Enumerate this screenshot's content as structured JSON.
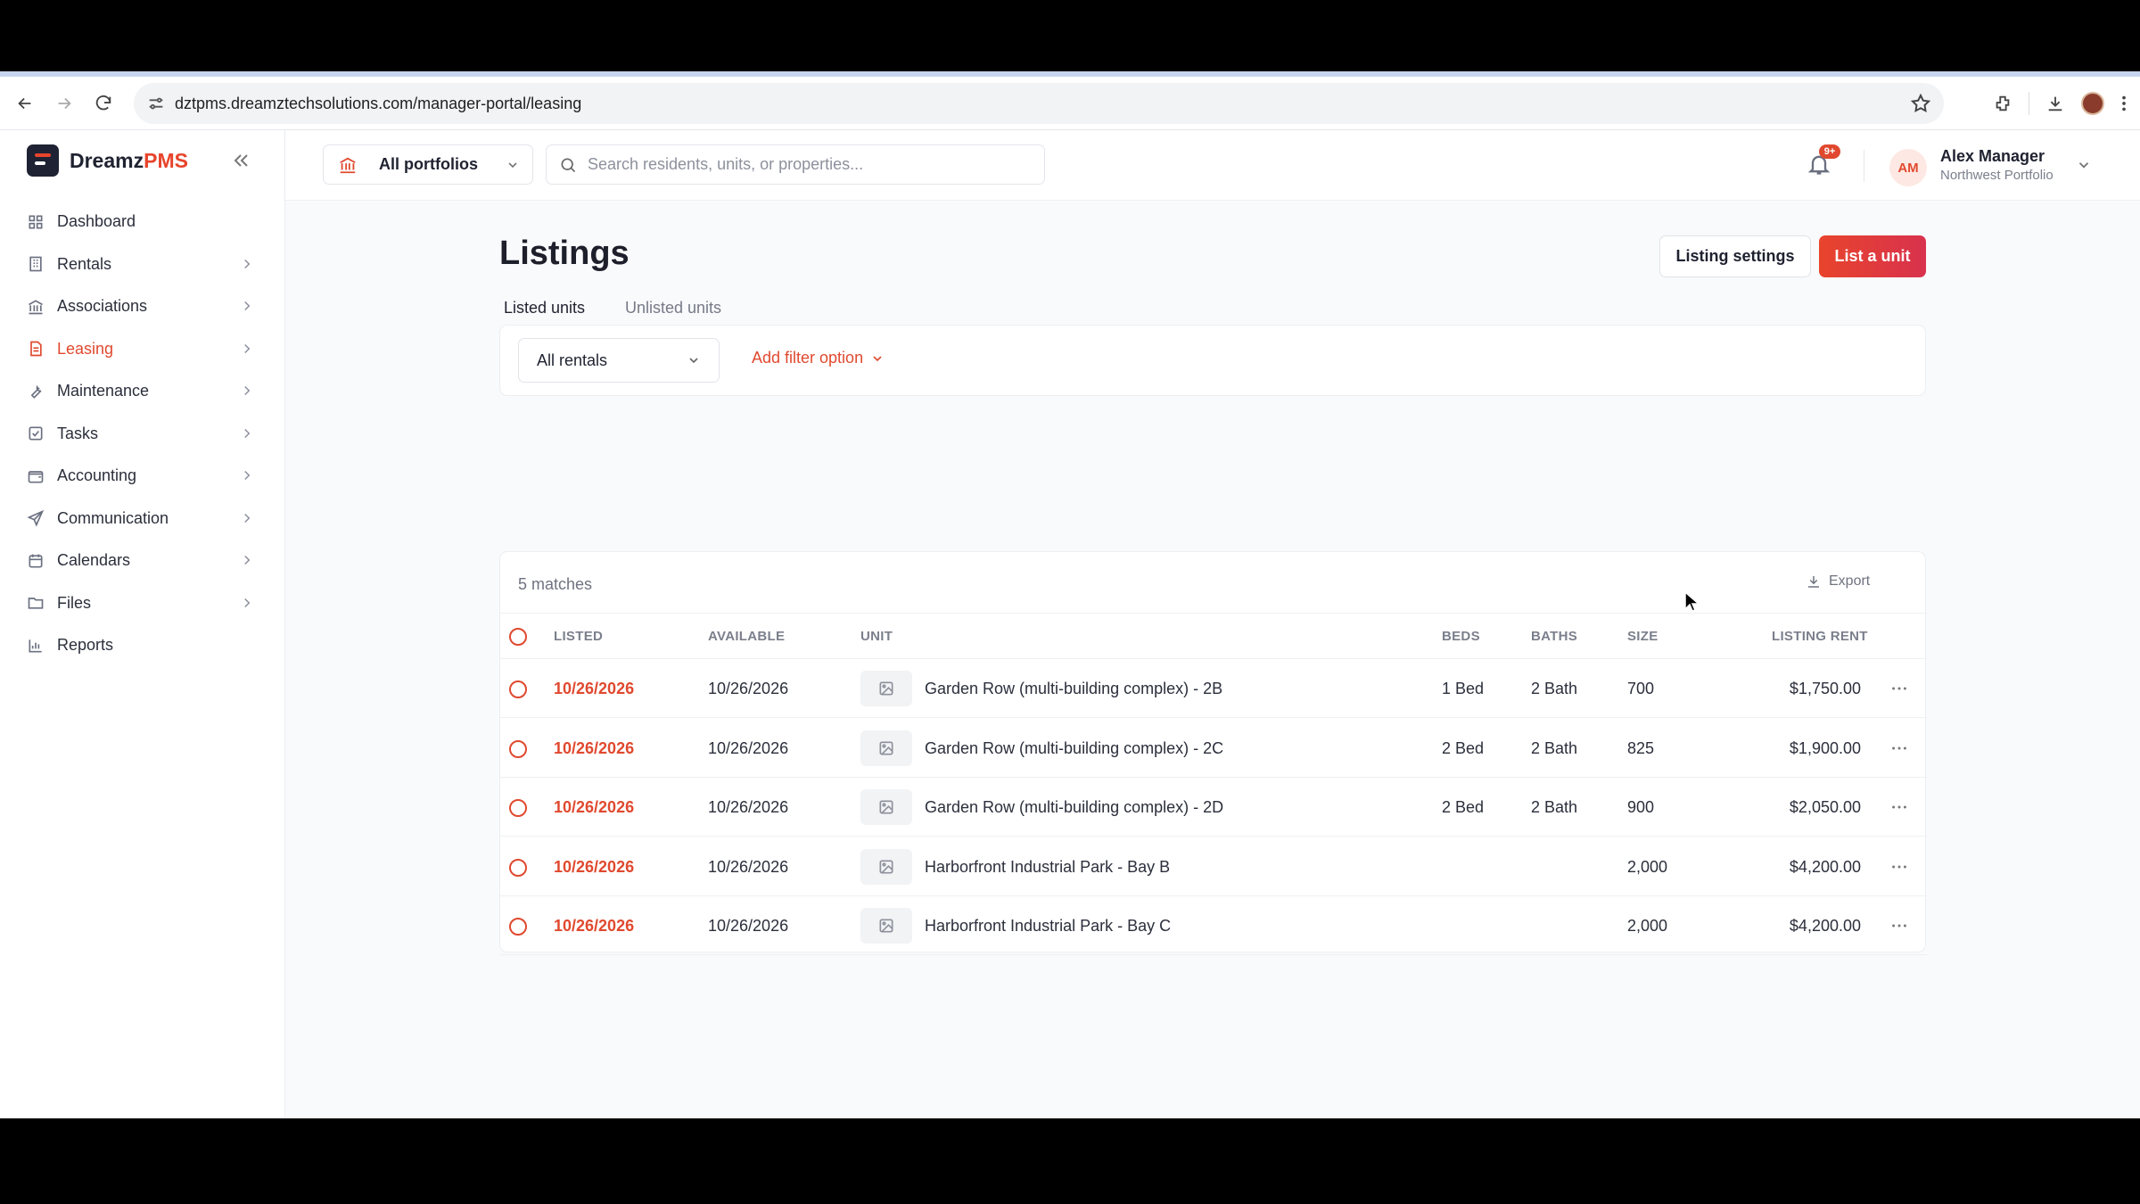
{
  "browser": {
    "url": "dztpms.dreamztechsolutions.com/manager-portal/leasing"
  },
  "brand": {
    "name_main": "Dreamz",
    "name_accent": "PMS"
  },
  "sidebar": {
    "items": [
      {
        "label": "Dashboard",
        "icon": "grid-icon",
        "has_chevron": false,
        "active": false
      },
      {
        "label": "Rentals",
        "icon": "building-icon",
        "has_chevron": true,
        "active": false
      },
      {
        "label": "Associations",
        "icon": "bank-icon",
        "has_chevron": true,
        "active": false
      },
      {
        "label": "Leasing",
        "icon": "document-icon",
        "has_chevron": true,
        "active": true
      },
      {
        "label": "Maintenance",
        "icon": "wrench-icon",
        "has_chevron": true,
        "active": false
      },
      {
        "label": "Tasks",
        "icon": "checkbox-icon",
        "has_chevron": true,
        "active": false
      },
      {
        "label": "Accounting",
        "icon": "wallet-icon",
        "has_chevron": true,
        "active": false
      },
      {
        "label": "Communication",
        "icon": "send-icon",
        "has_chevron": true,
        "active": false
      },
      {
        "label": "Calendars",
        "icon": "calendar-icon",
        "has_chevron": true,
        "active": false
      },
      {
        "label": "Files",
        "icon": "folder-icon",
        "has_chevron": true,
        "active": false
      },
      {
        "label": "Reports",
        "icon": "bar-chart-icon",
        "has_chevron": false,
        "active": false
      }
    ]
  },
  "header": {
    "portfolio_label": "All portfolios",
    "search_placeholder": "Search residents, units, or properties...",
    "notification_badge": "9+",
    "user_initials": "AM",
    "user_name": "Alex Manager",
    "user_portfolio": "Northwest Portfolio"
  },
  "page": {
    "title": "Listings",
    "settings_button": "Listing settings",
    "primary_button": "List a unit",
    "tabs": [
      {
        "label": "Listed units",
        "active": true
      },
      {
        "label": "Unlisted units",
        "active": false
      }
    ],
    "filter_select": "All rentals",
    "add_filter": "Add filter option"
  },
  "table": {
    "matches": "5 matches",
    "export_label": "Export",
    "columns": {
      "listed": "LISTED",
      "available": "AVAILABLE",
      "unit": "UNIT",
      "beds": "BEDS",
      "baths": "BATHS",
      "size": "SIZE",
      "rent": "LISTING RENT"
    },
    "rows": [
      {
        "listed": "10/26/2026",
        "available": "10/26/2026",
        "unit": "Garden Row (multi-building complex) - 2B",
        "beds": "1 Bed",
        "baths": "2 Bath",
        "size": "700",
        "rent": "$1,750.00"
      },
      {
        "listed": "10/26/2026",
        "available": "10/26/2026",
        "unit": "Garden Row (multi-building complex) - 2C",
        "beds": "2 Bed",
        "baths": "2 Bath",
        "size": "825",
        "rent": "$1,900.00"
      },
      {
        "listed": "10/26/2026",
        "available": "10/26/2026",
        "unit": "Garden Row (multi-building complex) - 2D",
        "beds": "2 Bed",
        "baths": "2 Bath",
        "size": "900",
        "rent": "$2,050.00"
      },
      {
        "listed": "10/26/2026",
        "available": "10/26/2026",
        "unit": "Harborfront Industrial Park - Bay B",
        "beds": "",
        "baths": "",
        "size": "2,000",
        "rent": "$4,200.00"
      },
      {
        "listed": "10/26/2026",
        "available": "10/26/2026",
        "unit": "Harborfront Industrial Park - Bay C",
        "beds": "",
        "baths": "",
        "size": "2,000",
        "rent": "$4,200.00"
      }
    ]
  },
  "colors": {
    "accent": "#e0492f",
    "brand_dark": "#1e2233"
  }
}
